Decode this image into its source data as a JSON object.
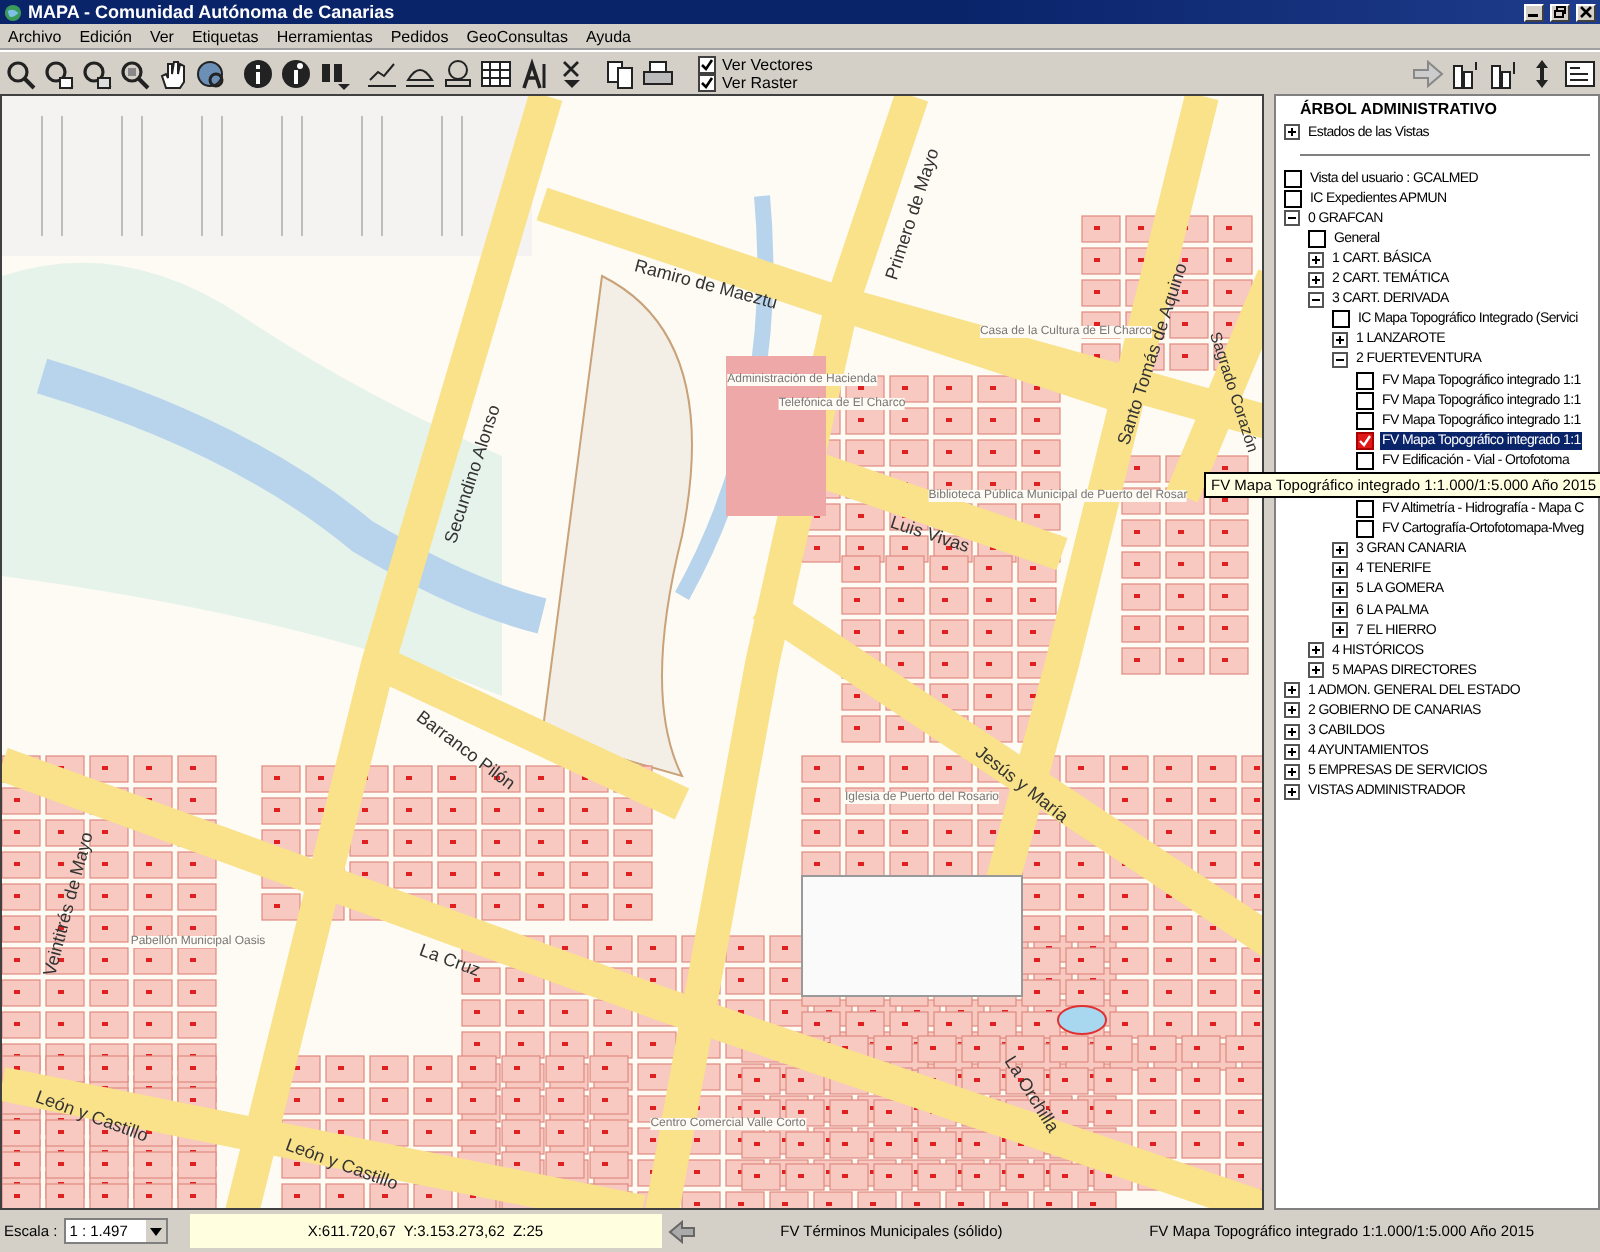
{
  "window": {
    "title": "MAPA - Comunidad Autónoma de Canarias"
  },
  "menu": [
    "Archivo",
    "Edición",
    "Ver",
    "Etiquetas",
    "Herramientas",
    "Pedidos",
    "GeoConsultas",
    "Ayuda"
  ],
  "toolbar": {
    "toggles": [
      {
        "label": "Ver Vectores",
        "checked": true
      },
      {
        "label": "Ver Raster",
        "checked": true
      }
    ]
  },
  "map": {
    "street_labels": [
      "Ramiro de Maeztu",
      "Primero de Mayo",
      "Santo Tomás de Aquino",
      "Sagrado Corazón",
      "Secundino Alonso",
      "Luis Vivas",
      "Barranco Pilón",
      "Jesús y María",
      "La Cruz",
      "Veintitrés de Mayo",
      "León y Castillo",
      "León y Castillo",
      "La Orchilla"
    ],
    "place_labels": [
      "Administración de Hacienda",
      "Telefónica de El Charco",
      "Casa de la Cultura de El Charco",
      "Biblioteca Pública Municipal de Puerto del Rosar",
      "Iglesia de Puerto del Rosario",
      "Pabellón Municipal Oasis",
      "Centro Comercial Valle Corto"
    ]
  },
  "tree": {
    "title": "ÁRBOL ADMINISTRATIVO",
    "states": {
      "label": "Estados de las Vistas",
      "expanded": false
    },
    "items": [
      {
        "kind": "check",
        "label": "Vista del usuario : GCALMED",
        "checked": false,
        "selected": false
      },
      {
        "kind": "check",
        "label": "IC Expedientes APMUN",
        "checked": false,
        "selected": false
      },
      {
        "kind": "folder",
        "label": "0 GRAFCAN",
        "expanded": true,
        "selected": false,
        "children": [
          {
            "kind": "check",
            "label": "General",
            "checked": false,
            "selected": false
          },
          {
            "kind": "folder",
            "label": "1 CART. BÁSICA",
            "expanded": false,
            "selected": false
          },
          {
            "kind": "folder",
            "label": "2 CART. TEMÁTICA",
            "expanded": false,
            "selected": false
          },
          {
            "kind": "folder",
            "label": "3 CART. DERIVADA",
            "expanded": true,
            "selected": false,
            "children": [
              {
                "kind": "check",
                "label": "IC Mapa Topográfico Integrado (Servici",
                "checked": false,
                "selected": false
              },
              {
                "kind": "folder",
                "label": "1 LANZAROTE",
                "expanded": false,
                "selected": false
              },
              {
                "kind": "folder",
                "label": "2 FUERTEVENTURA",
                "expanded": true,
                "selected": false,
                "children": [
                  {
                    "kind": "check",
                    "label": "FV Mapa Topográfico integrado 1:1",
                    "checked": false,
                    "selected": false
                  },
                  {
                    "kind": "check",
                    "label": "FV Mapa Topográfico integrado 1:1",
                    "checked": false,
                    "selected": false
                  },
                  {
                    "kind": "check",
                    "label": "FV Mapa Topográfico integrado 1:1",
                    "checked": false,
                    "selected": false
                  },
                  {
                    "kind": "check",
                    "label": "FV Mapa Topográfico integrado 1:1",
                    "checked": true,
                    "selected": true
                  },
                  {
                    "kind": "check",
                    "label": "FV Edificación - Vial - Ortofotoma",
                    "checked": false,
                    "selected": false
                  },
                  {
                    "kind": "check",
                    "label": "FV Altimetría - Hidrografía - Mapa C",
                    "checked": false,
                    "selected": false
                  },
                  {
                    "kind": "check",
                    "label": "FV Cartografía-Ortofotomapa-Mveg",
                    "checked": false,
                    "selected": false
                  }
                ]
              },
              {
                "kind": "folder",
                "label": "3 GRAN CANARIA",
                "expanded": false,
                "selected": false
              },
              {
                "kind": "folder",
                "label": "4 TENERIFE",
                "expanded": false,
                "selected": false
              },
              {
                "kind": "folder",
                "label": "5 LA GOMERA",
                "expanded": false,
                "selected": false
              },
              {
                "kind": "folder",
                "label": "6 LA PALMA",
                "expanded": false,
                "selected": false
              },
              {
                "kind": "folder",
                "label": "7 EL HIERRO",
                "expanded": false,
                "selected": false
              }
            ]
          },
          {
            "kind": "folder",
            "label": "4 HISTÓRICOS",
            "expanded": false,
            "selected": false
          },
          {
            "kind": "folder",
            "label": "5 MAPAS DIRECTORES",
            "expanded": false,
            "selected": false
          }
        ]
      },
      {
        "kind": "folder",
        "label": "1 ADMON. GENERAL DEL ESTADO",
        "expanded": false,
        "selected": false
      },
      {
        "kind": "folder",
        "label": "2 GOBIERNO DE CANARIAS",
        "expanded": false,
        "selected": false
      },
      {
        "kind": "folder",
        "label": "3 CABILDOS",
        "expanded": false,
        "selected": false
      },
      {
        "kind": "folder",
        "label": "4 AYUNTAMIENTOS",
        "expanded": false,
        "selected": false
      },
      {
        "kind": "folder",
        "label": "5 EMPRESAS DE SERVICIOS",
        "expanded": false,
        "selected": false
      },
      {
        "kind": "folder",
        "label": "VISTAS ADMINISTRADOR",
        "expanded": false,
        "selected": false
      }
    ]
  },
  "tooltip": {
    "text": "FV Mapa Topográfico integrado 1:1.000/1:5.000 Año 2015"
  },
  "status_bar": {
    "scale_label": "Escala :",
    "scale": "1 : 1.497",
    "coordinates": "X:611.720,67  Y:3.153.273,62  Z:25",
    "layer": "FV Términos Municipales (sólido)",
    "active_view": "FV Mapa Topográfico integrado 1:1.000/1:5.000 Año 2015"
  }
}
